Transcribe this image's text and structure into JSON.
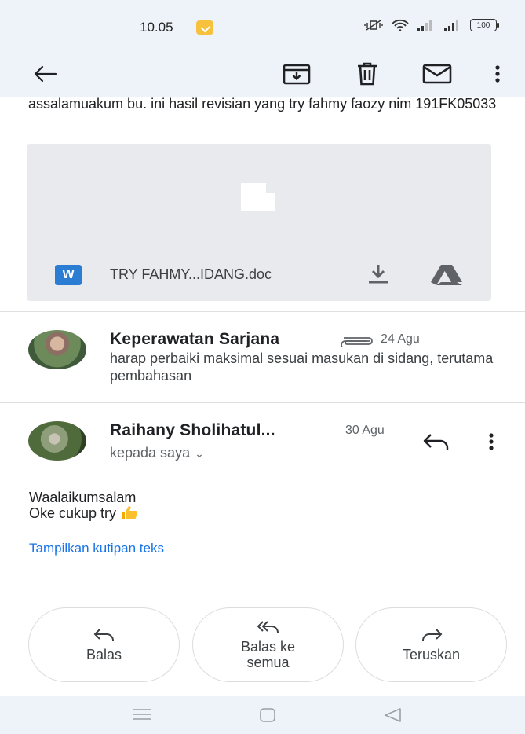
{
  "status_bar": {
    "time": "10.05",
    "battery": "100"
  },
  "toolbar": {
    "back": "back-arrow-icon",
    "archive": "archive-icon",
    "delete": "trash-icon",
    "mark_unread": "mail-icon",
    "more": "more-vert-icon"
  },
  "email_body": {
    "text": "assalamuakum bu. ini hasil revisian yang try fahmy faozy nim 191FK05033"
  },
  "attachment": {
    "type_badge": "W",
    "filename": "TRY FAHMY...IDANG.doc"
  },
  "messages": [
    {
      "sender": "Keperawatan Sarjana",
      "date": "24 Agu",
      "snippet": "harap perbaiki maksimal sesuai masukan di sidang, terutama pembahasan",
      "has_attachment": true
    },
    {
      "sender": "Raihany Sholihatul...",
      "date": "30 Agu",
      "recipient": "kepada saya",
      "body_line1": "Waalaikumsalam",
      "body_line2": "Oke cukup try",
      "show_quote": "Tampilkan kutipan teks"
    }
  ],
  "actions": {
    "reply": "Balas",
    "reply_all": "Balas ke\nsemua",
    "forward": "Teruskan"
  },
  "colors": {
    "accent": "#1a73e8",
    "bar_bg": "#eef3f9",
    "word_blue": "#2b7cd3"
  }
}
